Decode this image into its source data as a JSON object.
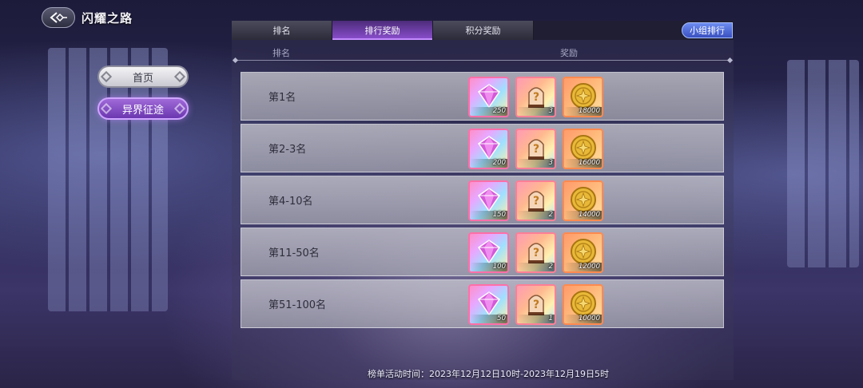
{
  "header": {
    "title": "闪耀之路"
  },
  "sidebar": {
    "items": [
      {
        "label": "首页"
      },
      {
        "label": "异界征途"
      }
    ]
  },
  "tabs": [
    {
      "label": "排名"
    },
    {
      "label": "排行奖励"
    },
    {
      "label": "积分奖励"
    }
  ],
  "active_tab": "排行奖励",
  "group_rank_button": "小组排行",
  "columns": {
    "rank": "排名",
    "reward": "奖励"
  },
  "rows": [
    {
      "rank": "第1名",
      "rewards": [
        {
          "icon": "gem-icon",
          "qty": "250"
        },
        {
          "icon": "mystery-box-icon",
          "qty": "3"
        },
        {
          "icon": "gold-coin-icon",
          "qty": "18000"
        }
      ]
    },
    {
      "rank": "第2-3名",
      "rewards": [
        {
          "icon": "gem-icon",
          "qty": "200"
        },
        {
          "icon": "mystery-box-icon",
          "qty": "3"
        },
        {
          "icon": "gold-coin-icon",
          "qty": "16000"
        }
      ]
    },
    {
      "rank": "第4-10名",
      "rewards": [
        {
          "icon": "gem-icon",
          "qty": "150"
        },
        {
          "icon": "mystery-box-icon",
          "qty": "2"
        },
        {
          "icon": "gold-coin-icon",
          "qty": "14000"
        }
      ]
    },
    {
      "rank": "第11-50名",
      "rewards": [
        {
          "icon": "gem-icon",
          "qty": "100"
        },
        {
          "icon": "mystery-box-icon",
          "qty": "2"
        },
        {
          "icon": "gold-coin-icon",
          "qty": "12000"
        }
      ]
    },
    {
      "rank": "第51-100名",
      "rewards": [
        {
          "icon": "gem-icon",
          "qty": "50"
        },
        {
          "icon": "mystery-box-icon",
          "qty": "1"
        },
        {
          "icon": "gold-coin-icon",
          "qty": "10000"
        }
      ]
    }
  ],
  "footer": {
    "time": "榜单活动时间：2023年12月12日10时-2023年12月19日5时"
  },
  "colors": {
    "accent_purple": "#8c4fd0",
    "group_button_blue": "#3a50c0"
  }
}
